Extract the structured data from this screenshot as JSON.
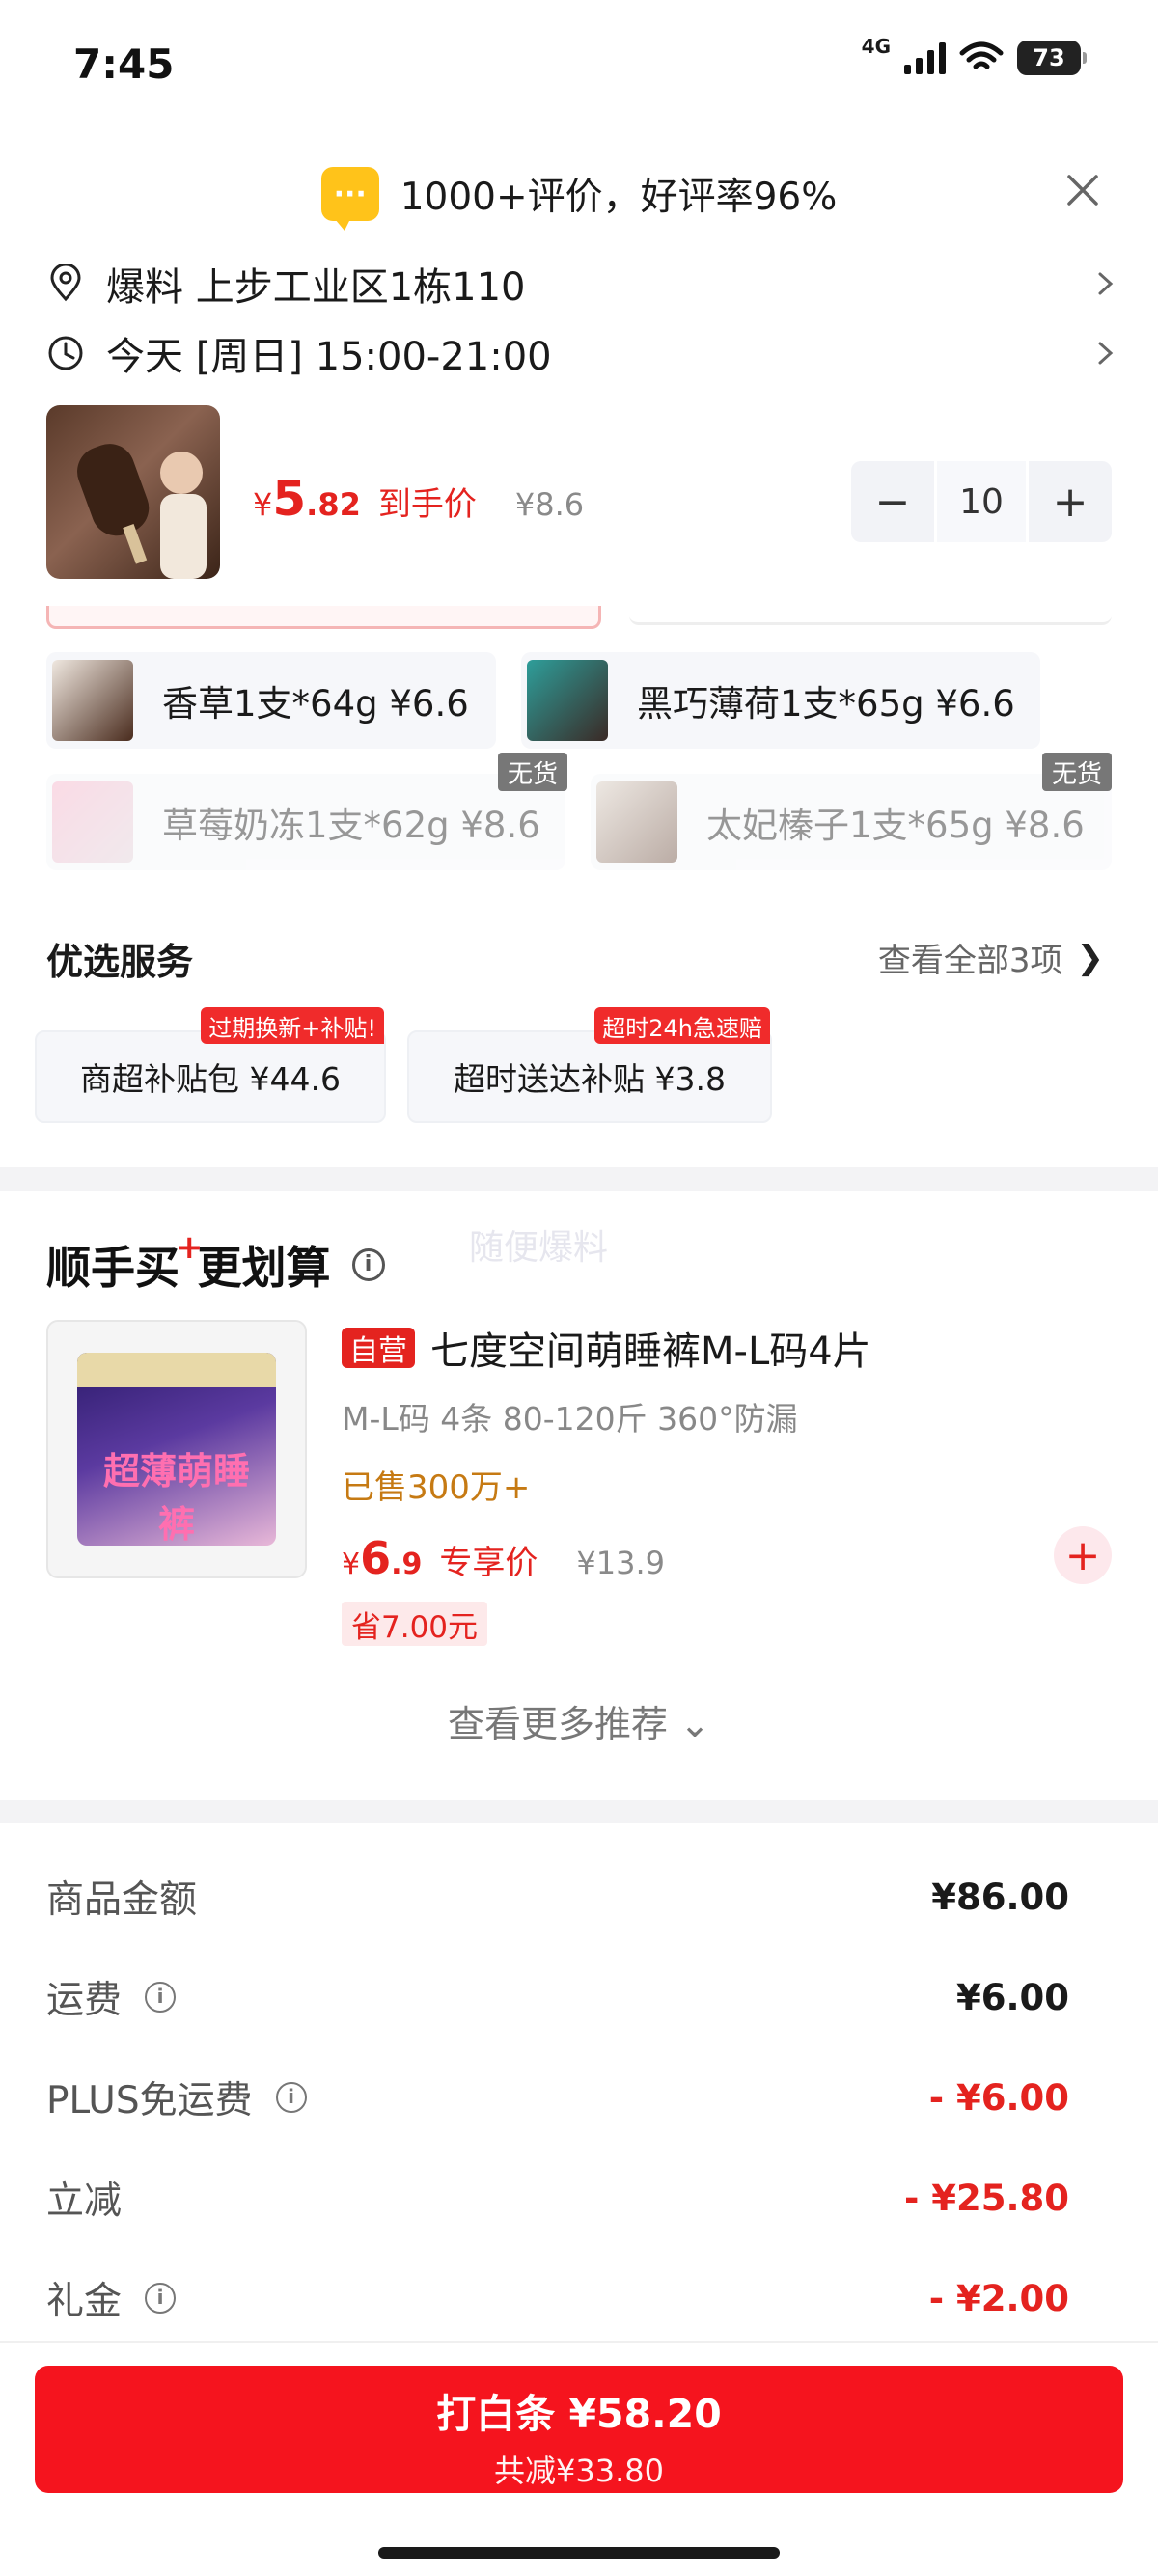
{
  "status_bar": {
    "time": "7:45",
    "network": "4G",
    "battery": "73"
  },
  "rating": {
    "text": "1000+评价，好评率96%",
    "icon_glyph": "···"
  },
  "address": {
    "text": "爆料   上步工业区1栋110"
  },
  "delivery": {
    "text": "今天 [周日] 15:00-21:00"
  },
  "product": {
    "currency": "¥",
    "price_int": "5",
    "price_dec": ".82",
    "price_tag": "到手价",
    "original_price": "¥8.6",
    "quantity": "10",
    "minus": "−",
    "plus": "+"
  },
  "variants": [
    {
      "name": "香草1支*64g  ¥6.6",
      "available": true
    },
    {
      "name": "黑巧薄荷1支*65g  ¥6.6",
      "available": true
    },
    {
      "name": "草莓奶冻1支*62g  ¥8.6",
      "available": false,
      "badge": "无货"
    },
    {
      "name": "太妃榛子1支*65g  ¥8.6",
      "available": false,
      "badge": "无货"
    }
  ],
  "services": {
    "title": "优选服务",
    "view_all": "查看全部3项",
    "view_all_arrow": "❯",
    "items": [
      {
        "label": "商超补贴包  ¥44.6",
        "badge": "过期换新+补贴!"
      },
      {
        "label": "超时送达补贴  ¥3.8",
        "badge": "超时24h急速赔"
      }
    ]
  },
  "recommend": {
    "title_a": "顺手买",
    "title_plus": "+",
    "title_b": "更划算",
    "info_glyph": "i",
    "watermark": "随便爆料",
    "badge": "自营",
    "name": "七度空间萌睡裤M-L码4片",
    "spec": "M-L码 4条 80-120斤 360°防漏",
    "sold": "已售300万+",
    "currency": "¥",
    "price_int": "6",
    "price_dec": ".9",
    "price_tag": "专享价",
    "original_price": "¥13.9",
    "save": "省7.00元",
    "add": "+",
    "package_text": "超薄萌睡裤",
    "more": "查看更多推荐 ⌄"
  },
  "summary": [
    {
      "label": "商品金额",
      "value": "¥86.00",
      "info": false,
      "negative": false
    },
    {
      "label": "运费",
      "value": "¥6.00",
      "info": true,
      "negative": false
    },
    {
      "label": "PLUS免运费",
      "value": "- ¥6.00",
      "info": true,
      "negative": true
    },
    {
      "label": "立减",
      "value": "- ¥25.80",
      "info": false,
      "negative": true
    },
    {
      "label": "礼金",
      "value": "- ¥2.00",
      "info": true,
      "negative": true
    }
  ],
  "pay": {
    "main": "打白条 ¥58.20",
    "sub": "共减¥33.80"
  },
  "colors": {
    "accent_red": "#e4231f",
    "pay_red": "#f5141e",
    "rating_yellow": "#ffc31a"
  }
}
